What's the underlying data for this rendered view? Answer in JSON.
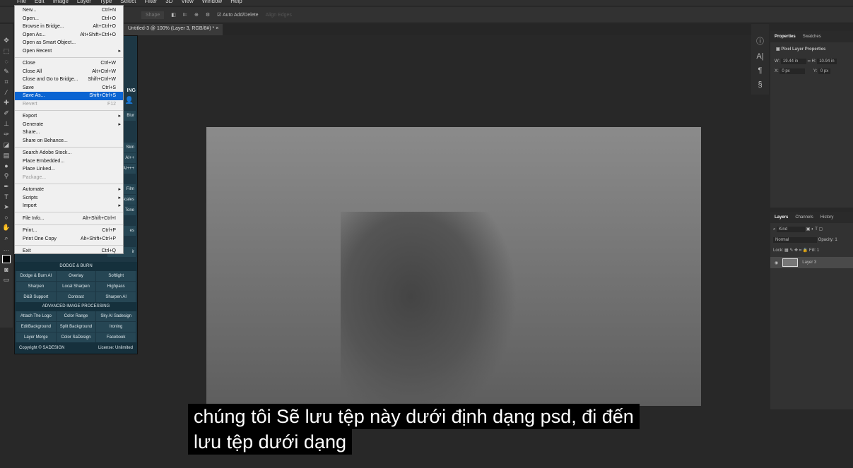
{
  "menubar": [
    "File",
    "Edit",
    "Image",
    "Layer",
    "Type",
    "Select",
    "Filter",
    "3D",
    "View",
    "Window",
    "Help"
  ],
  "options": {
    "shape": "Shape",
    "auto_add": "Auto Add/Delete",
    "align": "Align Edges"
  },
  "document_tab": "Untitled-3 @ 100% (Layer 3, RGB/8#) * ×",
  "file_menu": [
    {
      "label": "New...",
      "shortcut": "Ctrl+N"
    },
    {
      "label": "Open...",
      "shortcut": "Ctrl+O"
    },
    {
      "label": "Browse in Bridge...",
      "shortcut": "Alt+Ctrl+O"
    },
    {
      "label": "Open As...",
      "shortcut": "Alt+Shift+Ctrl+O"
    },
    {
      "label": "Open as Smart Object...",
      "shortcut": ""
    },
    {
      "label": "Open Recent",
      "shortcut": "",
      "sub": true
    },
    {
      "sep": true
    },
    {
      "label": "Close",
      "shortcut": "Ctrl+W"
    },
    {
      "label": "Close All",
      "shortcut": "Alt+Ctrl+W"
    },
    {
      "label": "Close and Go to Bridge...",
      "shortcut": "Shift+Ctrl+W"
    },
    {
      "label": "Save",
      "shortcut": "Ctrl+S"
    },
    {
      "label": "Save As...",
      "shortcut": "Shift+Ctrl+S",
      "hl": true
    },
    {
      "label": "Revert",
      "shortcut": "F12",
      "dis": true
    },
    {
      "sep": true
    },
    {
      "label": "Export",
      "shortcut": "",
      "sub": true
    },
    {
      "label": "Generate",
      "shortcut": "",
      "sub": true
    },
    {
      "label": "Share...",
      "shortcut": ""
    },
    {
      "label": "Share on Behance...",
      "shortcut": ""
    },
    {
      "sep": true
    },
    {
      "label": "Search Adobe Stock...",
      "shortcut": ""
    },
    {
      "label": "Place Embedded...",
      "shortcut": ""
    },
    {
      "label": "Place Linked...",
      "shortcut": ""
    },
    {
      "label": "Package...",
      "shortcut": "",
      "dis": true
    },
    {
      "sep": true
    },
    {
      "label": "Automate",
      "shortcut": "",
      "sub": true
    },
    {
      "label": "Scripts",
      "shortcut": "",
      "sub": true
    },
    {
      "label": "Import",
      "shortcut": "",
      "sub": true
    },
    {
      "sep": true
    },
    {
      "label": "File Info...",
      "shortcut": "Alt+Shift+Ctrl+I"
    },
    {
      "sep": true
    },
    {
      "label": "Print...",
      "shortcut": "Ctrl+P"
    },
    {
      "label": "Print One Copy",
      "shortcut": "Alt+Shift+Ctrl+P"
    },
    {
      "sep": true
    },
    {
      "label": "Exit",
      "shortcut": "Ctrl+Q"
    }
  ],
  "plugin": {
    "partial": [
      "ING",
      "Blur",
      "Skin",
      "AI++",
      "AI+++",
      "Film",
      "Scales",
      "Tone",
      "es",
      "ir"
    ],
    "dodge_title": "DODGE & BURN",
    "dodge": [
      "Dodge & Burn AI",
      "Overlay",
      "Softlight",
      "Sharpen",
      "Local Sharpen",
      "Highpass",
      "D&B Support",
      "Contrast",
      "Sharpen AI"
    ],
    "adv_title": "ADVANCED IMAGE PROCESSING",
    "adv": [
      "Attach The Logo",
      "Color Range",
      "Sky AI Sadesign",
      "EditBackground",
      "Split Background",
      "Ironing",
      "Layer Merge",
      "Color SaDesign",
      "Facebook"
    ],
    "copyright": "Copyright © SADESIGN",
    "license": "License: Unlimited"
  },
  "properties": {
    "tabs": [
      "Properties",
      "Swatches"
    ],
    "title": "Pixel Layer Properties",
    "w_label": "W:",
    "w": "19.44 in",
    "h_label": "H:",
    "h": "10.94 in",
    "x_label": "X:",
    "x": "0 px",
    "y_label": "Y:",
    "y": "0 px"
  },
  "layers": {
    "tabs": [
      "Layers",
      "Channels",
      "History"
    ],
    "kind": "Kind",
    "blend": "Normal",
    "opacity_label": "Opacity: 1",
    "lock_label": "Lock:",
    "fill_label": "Fill: 1",
    "layer_name": "Layer 3"
  },
  "subtitles": [
    "chúng tôi  Sẽ lưu tệp này dưới định dạng psd, đi đến",
    "lưu tệp dưới dạng"
  ]
}
